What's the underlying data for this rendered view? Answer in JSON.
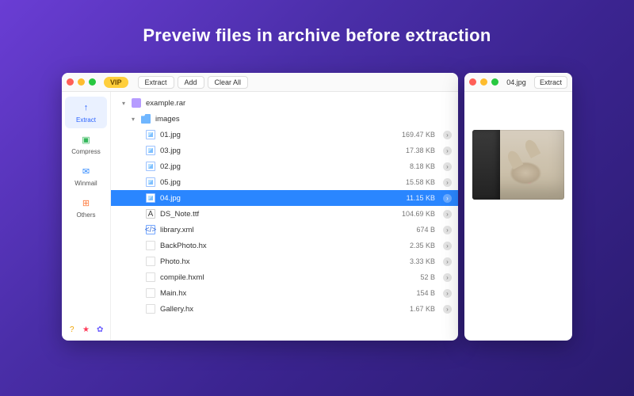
{
  "hero": {
    "title": "Preveiw files in archive before extraction"
  },
  "main": {
    "vip_label": "VIP",
    "toolbar": {
      "extract": "Extract",
      "add": "Add",
      "clear_all": "Clear All"
    },
    "sidebar": {
      "items": [
        {
          "label": "Extract",
          "icon": "↑",
          "color": "#2a63ff",
          "active": true
        },
        {
          "label": "Compress",
          "icon": "▣",
          "color": "#33b75a",
          "active": false
        },
        {
          "label": "Winmail",
          "icon": "✉",
          "color": "#2a86ff",
          "active": false
        },
        {
          "label": "Others",
          "icon": "⊞",
          "color": "#ff7a3c",
          "active": false
        }
      ],
      "footer_icons": [
        {
          "name": "help-icon",
          "glyph": "?",
          "color": "#f0a300"
        },
        {
          "name": "favorite-icon",
          "glyph": "★",
          "color": "#ff3b59"
        },
        {
          "name": "settings-icon",
          "glyph": "✿",
          "color": "#6a5cff"
        }
      ]
    },
    "tree": {
      "root": {
        "name": "example.rar"
      },
      "folder": {
        "name": "images"
      },
      "files": [
        {
          "name": "01.jpg",
          "size": "169.47 KB",
          "type": "img",
          "selected": false
        },
        {
          "name": "03.jpg",
          "size": "17.38 KB",
          "type": "img",
          "selected": false
        },
        {
          "name": "02.jpg",
          "size": "8.18 KB",
          "type": "img",
          "selected": false
        },
        {
          "name": "05.jpg",
          "size": "15.58 KB",
          "type": "img",
          "selected": false
        },
        {
          "name": "04.jpg",
          "size": "11.15 KB",
          "type": "img",
          "selected": true
        },
        {
          "name": "DS_Note.ttf",
          "size": "104.69 KB",
          "type": "font",
          "selected": false
        },
        {
          "name": "library.xml",
          "size": "674 B",
          "type": "xml",
          "selected": false
        },
        {
          "name": "BackPhoto.hx",
          "size": "2.35 KB",
          "type": "generic",
          "selected": false
        },
        {
          "name": "Photo.hx",
          "size": "3.33 KB",
          "type": "generic",
          "selected": false
        },
        {
          "name": "compile.hxml",
          "size": "52 B",
          "type": "generic",
          "selected": false
        },
        {
          "name": "Main.hx",
          "size": "154 B",
          "type": "generic",
          "selected": false
        },
        {
          "name": "Gallery.hx",
          "size": "1.67 KB",
          "type": "generic",
          "selected": false
        }
      ]
    }
  },
  "preview": {
    "title": "04.jpg",
    "extract": "Extract"
  }
}
